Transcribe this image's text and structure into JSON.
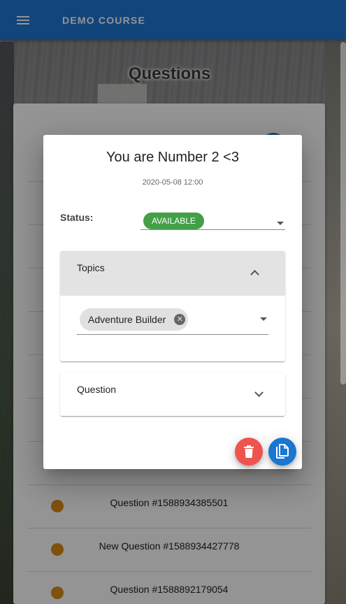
{
  "appbar": {
    "title": "DEMO COURSE"
  },
  "page": {
    "title": "Questions"
  },
  "list": {
    "rows": [
      {
        "label": "Question #1588934385501",
        "status_color": "#da8c16"
      },
      {
        "label": "New Question #1588934427778",
        "status_color": "#da8c16"
      },
      {
        "label": "Question #1588892179054",
        "status_color": "#da8c16"
      }
    ]
  },
  "dialog": {
    "title": "You are Number 2 <3",
    "date": "2020-05-08 12:00",
    "status": {
      "label": "Status:",
      "value": "AVAILABLE",
      "color": "#43a047"
    },
    "topics_panel": {
      "label": "Topics",
      "expanded": true,
      "chips": [
        "Adventure Builder"
      ]
    },
    "question_panel": {
      "label": "Question",
      "expanded": false
    },
    "actions": {
      "delete_color": "#ef5350",
      "copy_color": "#1976d2"
    }
  },
  "icons": [
    "menu-icon",
    "trash-icon",
    "copy-icon",
    "chevron-up-icon",
    "chevron-down-icon",
    "dropdown-arrow-icon",
    "cancel-icon"
  ]
}
